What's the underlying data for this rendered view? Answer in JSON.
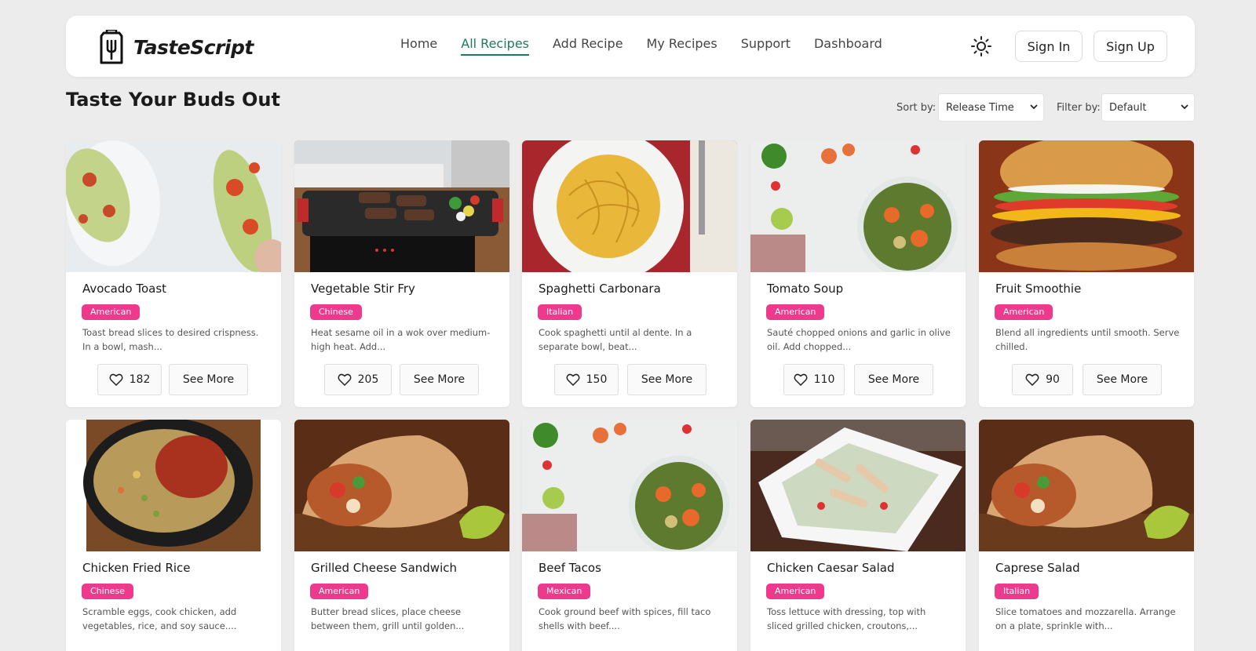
{
  "app": {
    "brand": "TasteScript"
  },
  "nav": {
    "items": [
      {
        "label": "Home",
        "active": false
      },
      {
        "label": "All Recipes",
        "active": true
      },
      {
        "label": "Add Recipe",
        "active": false
      },
      {
        "label": "My Recipes",
        "active": false
      },
      {
        "label": "Support",
        "active": false
      },
      {
        "label": "Dashboard",
        "active": false
      }
    ],
    "theme_icon": "sun-icon",
    "sign_in": "Sign In",
    "sign_up": "Sign Up"
  },
  "page": {
    "title": "Taste Your Buds Out",
    "sort_label": "Sort by:",
    "sort_value": "Release Time",
    "filter_label": "Filter by:",
    "filter_value": "Default"
  },
  "colors": {
    "accent_green": "#1e7a5a",
    "tag_pink": "#ee3a8c",
    "page_bg": "#ececec"
  },
  "recipes": [
    {
      "title": "Avocado Toast",
      "tag": "American",
      "desc": "Toast bread slices to desired crispness. In a bowl, mash...",
      "likes": "182",
      "more": "See More"
    },
    {
      "title": "Vegetable Stir Fry",
      "tag": "Chinese",
      "desc": "Heat sesame oil in a wok over medium-high heat. Add...",
      "likes": "205",
      "more": "See More"
    },
    {
      "title": "Spaghetti Carbonara",
      "tag": "Italian",
      "desc": "Cook spaghetti until al dente. In a separate bowl, beat...",
      "likes": "150",
      "more": "See More"
    },
    {
      "title": "Tomato Soup",
      "tag": "American",
      "desc": "Sauté chopped onions and garlic in olive oil. Add chopped...",
      "likes": "110",
      "more": "See More"
    },
    {
      "title": "Fruit Smoothie",
      "tag": "American",
      "desc": "Blend all ingredients until smooth. Serve chilled.",
      "likes": "90",
      "more": "See More"
    },
    {
      "title": "Chicken Fried Rice",
      "tag": "Chinese",
      "desc": "Scramble eggs, cook chicken, add vegetables, rice, and soy sauce....",
      "likes": "",
      "more": ""
    },
    {
      "title": "Grilled Cheese Sandwich",
      "tag": "American",
      "desc": "Butter bread slices, place cheese between them, grill until golden...",
      "likes": "",
      "more": ""
    },
    {
      "title": "Beef Tacos",
      "tag": "Mexican",
      "desc": "Cook ground beef with spices, fill taco shells with beef....",
      "likes": "",
      "more": ""
    },
    {
      "title": "Chicken Caesar Salad",
      "tag": "American",
      "desc": "Toss lettuce with dressing, top with sliced grilled chicken, croutons,...",
      "likes": "",
      "more": ""
    },
    {
      "title": "Caprese Salad",
      "tag": "Italian",
      "desc": "Slice tomatoes and mozzarella. Arrange on a plate, sprinkle with...",
      "likes": "",
      "more": ""
    }
  ]
}
